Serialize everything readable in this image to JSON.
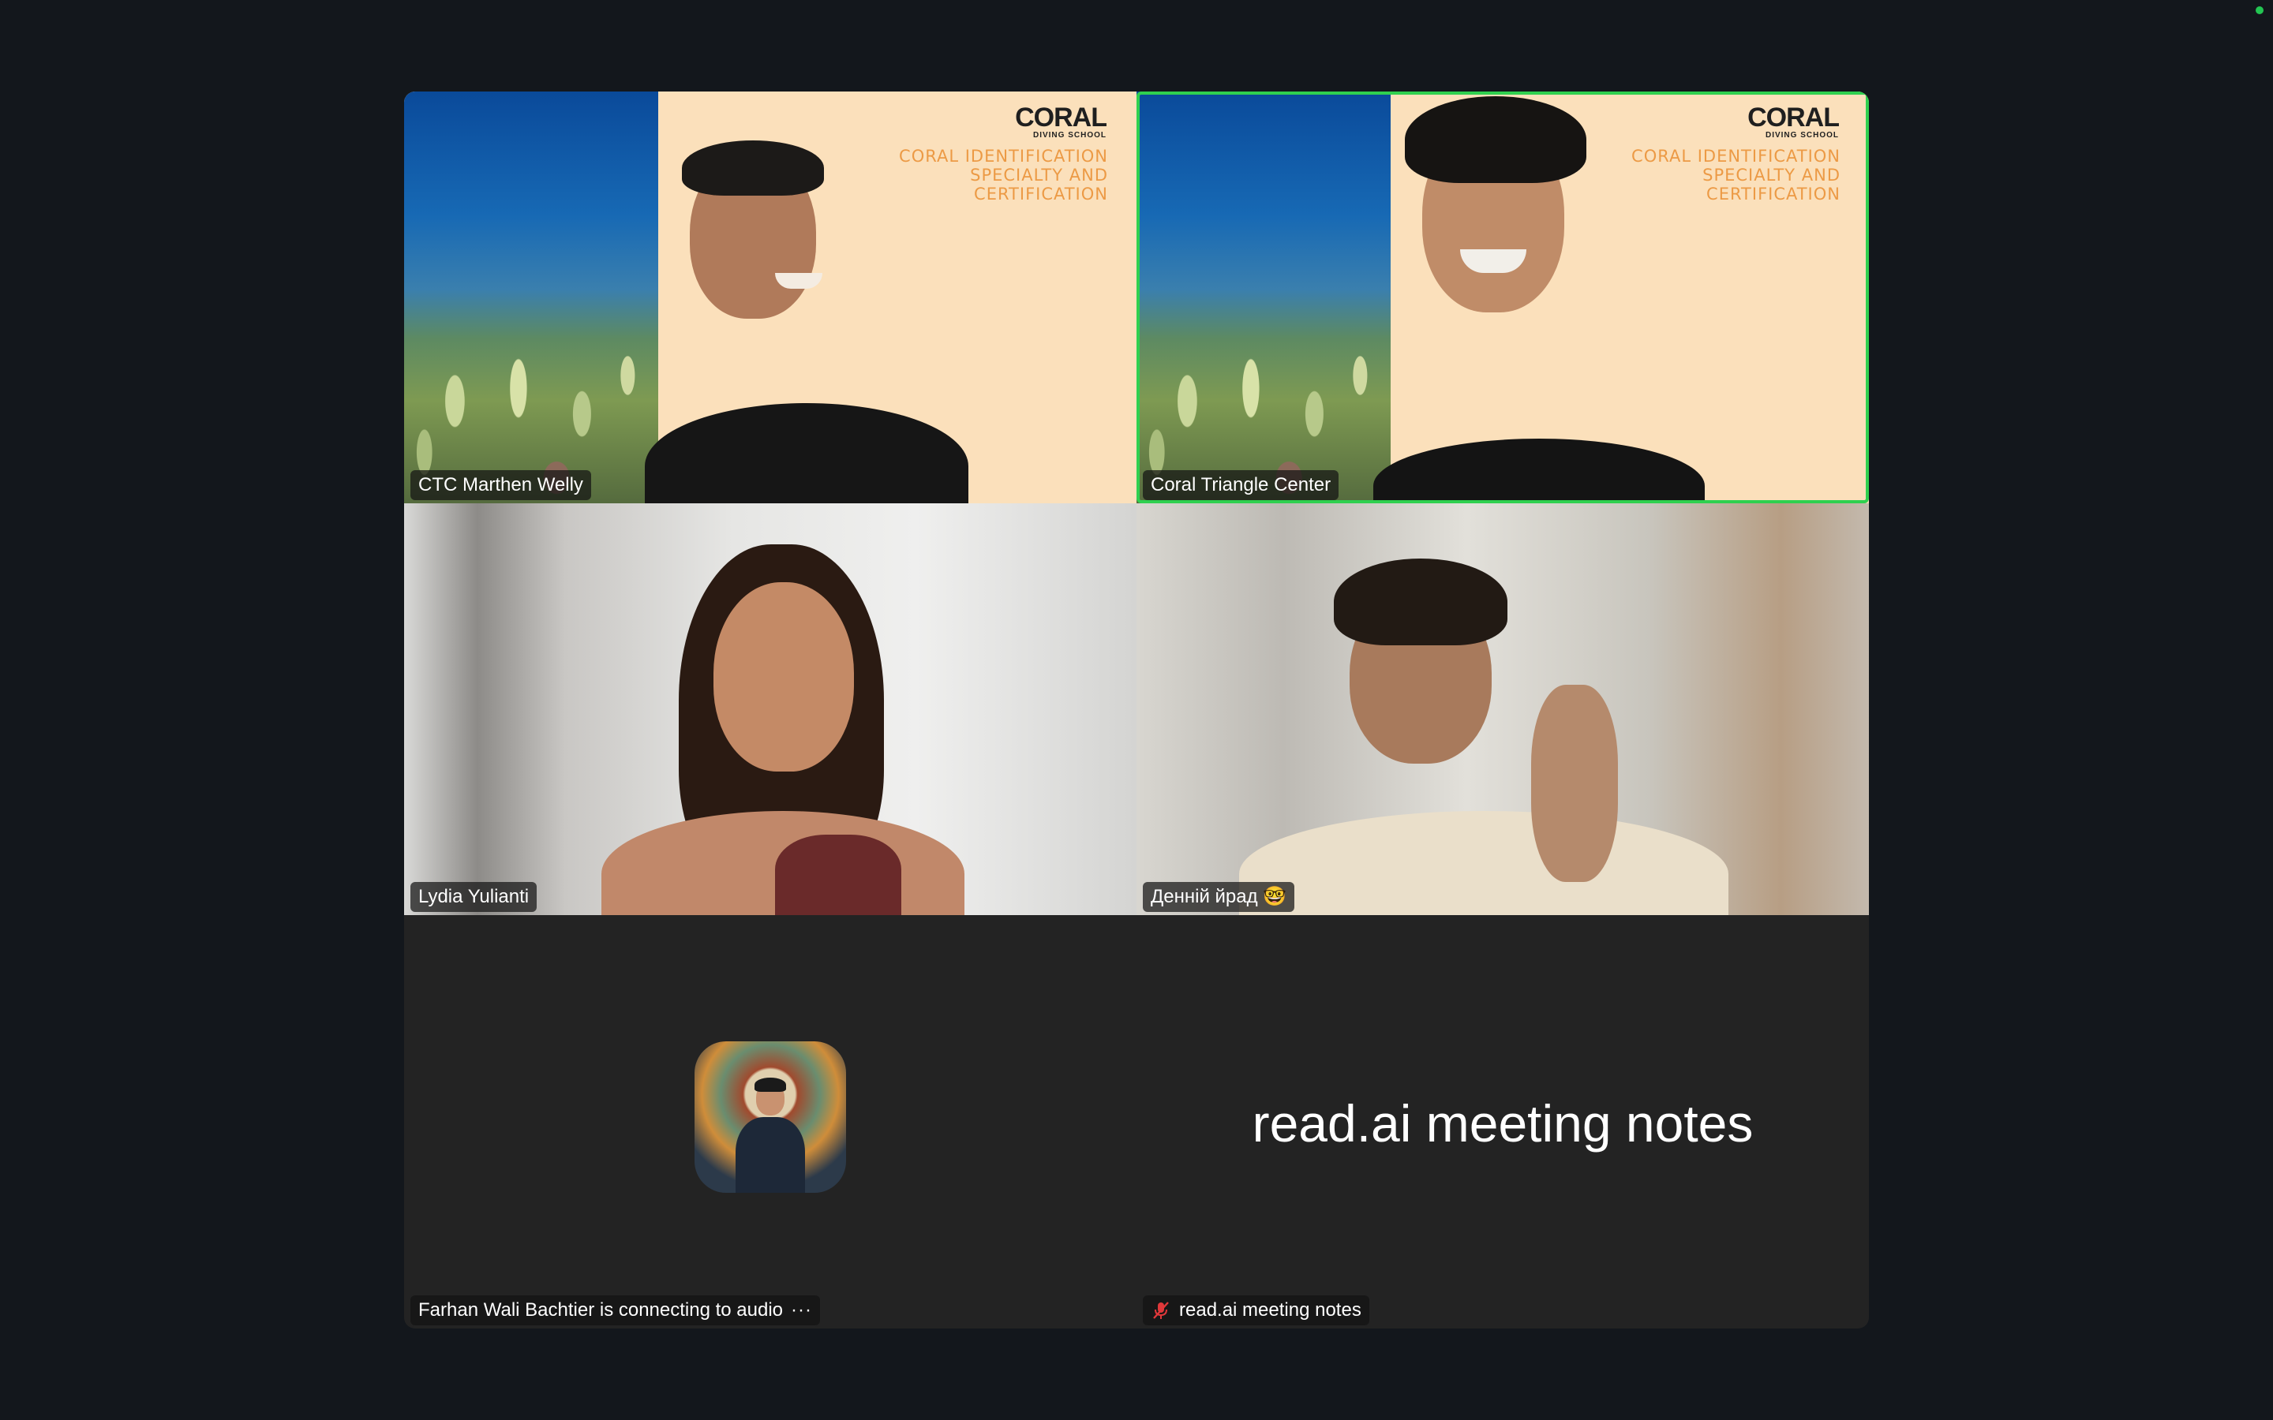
{
  "participants": [
    {
      "name": "CTC Marthen Welly",
      "background": {
        "logo": "CORAL",
        "logo_sub": "DIVING SCHOOL",
        "slide_title": "CORAL IDENTIFICATION\nSPECIALTY AND\nCERTIFICATION"
      }
    },
    {
      "name": "Coral Triangle Center",
      "active_speaker": true,
      "background": {
        "logo": "CORAL",
        "logo_sub": "DIVING SCHOOL",
        "slide_title": "CORAL IDENTIFICATION\nSPECIALTY AND\nCERTIFICATION"
      }
    },
    {
      "name": "Lydia Yulianti"
    },
    {
      "name": "Денній йрад 🤓"
    },
    {
      "name": "Farhan Wali Bachtier is connecting to audio",
      "more_glyph": "···"
    },
    {
      "name": "read.ai meeting notes",
      "display_label": "read.ai meeting notes",
      "muted": true
    }
  ],
  "colors": {
    "active_border": "#2fd04f",
    "window_bg": "#13171c",
    "tile_bg": "#232323",
    "slide_accent": "#ec9a45",
    "status_dot": "#23c552"
  }
}
